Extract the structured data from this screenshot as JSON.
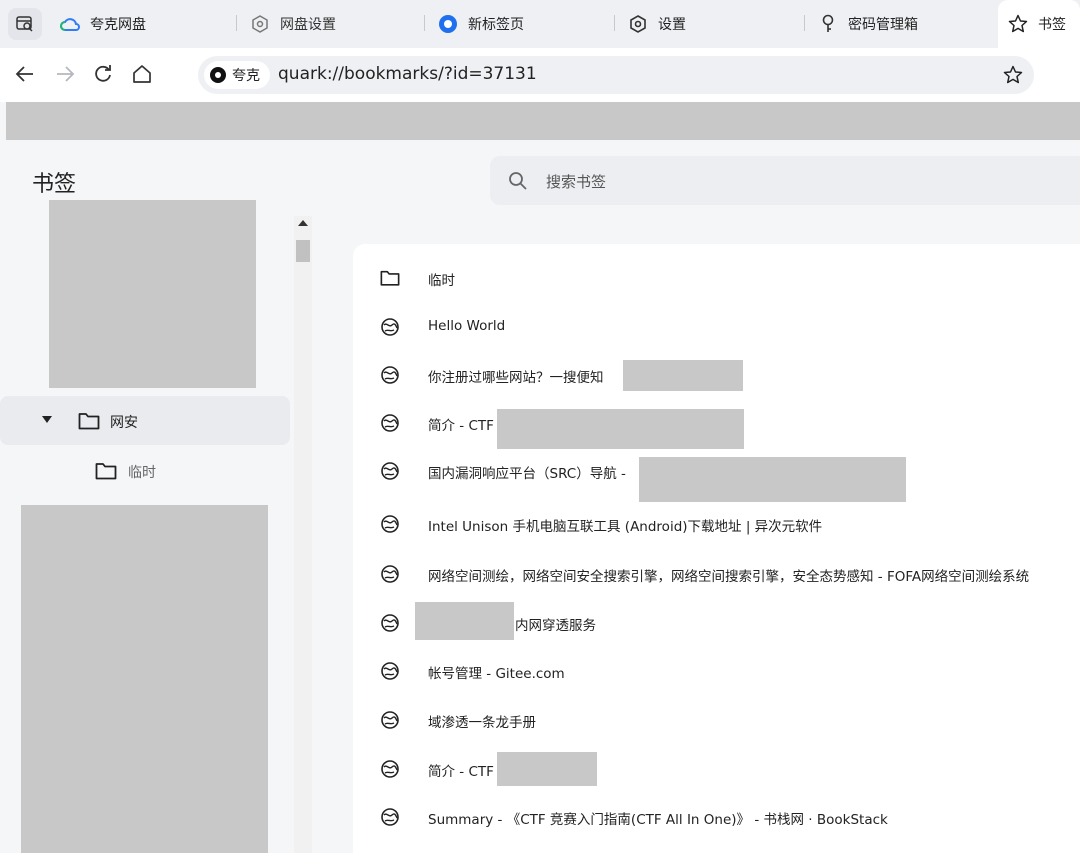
{
  "tabs": [
    {
      "label": "夸克网盘",
      "icon": "cloud-drive-icon"
    },
    {
      "label": "网盘设置",
      "icon": "settings-icon"
    },
    {
      "label": "新标签页",
      "icon": "quark-logo-icon"
    },
    {
      "label": "设置",
      "icon": "settings-icon"
    },
    {
      "label": "密码管理箱",
      "icon": "key-icon"
    },
    {
      "label": "书签",
      "icon": "star-icon",
      "active": true
    }
  ],
  "toolbar": {
    "site_chip": "夸克",
    "url": "quark://bookmarks/?id=37131"
  },
  "page": {
    "title": "书签",
    "search_placeholder": "搜索书签"
  },
  "tree": {
    "folder": "网安",
    "subfolder": "临时"
  },
  "bookmarks": [
    {
      "type": "folder",
      "title": "临时"
    },
    {
      "type": "link",
      "title": "Hello World"
    },
    {
      "type": "link",
      "title": "你注册过哪些网站？一搜便知"
    },
    {
      "type": "link",
      "title": "简介 - CTF"
    },
    {
      "type": "link",
      "title": "国内漏洞响应平台（SRC）导航 -"
    },
    {
      "type": "link",
      "title": "Intel Unison 手机电脑互联工具 (Android)下载地址 | 异次元软件"
    },
    {
      "type": "link",
      "title": "网络空间测绘，网络空间安全搜索引擎，网络空间搜索引擎，安全态势感知 - FOFA网络空间测绘系统"
    },
    {
      "type": "link",
      "title": "内网穿透服务"
    },
    {
      "type": "link",
      "title": "帐号管理 - Gitee.com"
    },
    {
      "type": "link",
      "title": "域渗透一条龙手册"
    },
    {
      "type": "link",
      "title": "简介 - CTF"
    },
    {
      "type": "link",
      "title": "Summary - 《CTF 竞赛入门指南(CTF All In One)》 - 书栈网 · BookStack"
    }
  ]
}
